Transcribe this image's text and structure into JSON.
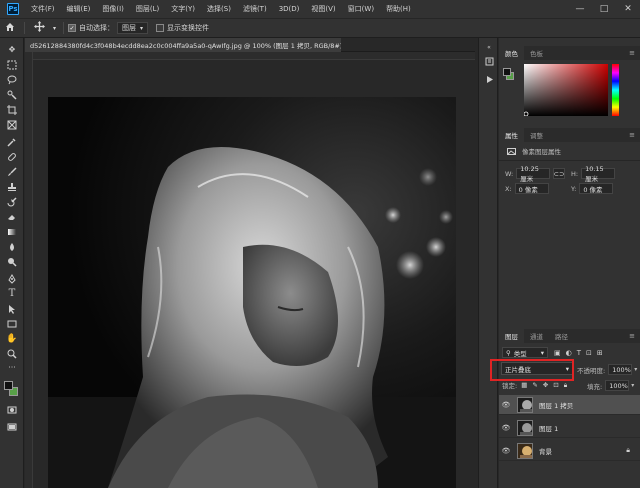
{
  "app": {
    "logo": "Ps"
  },
  "menu": [
    "文件(F)",
    "编辑(E)",
    "图像(I)",
    "图层(L)",
    "文字(Y)",
    "选择(S)",
    "滤镜(T)",
    "3D(D)",
    "视图(V)",
    "窗口(W)",
    "帮助(H)"
  ],
  "window_controls": {
    "minimize": "—",
    "maximize": "□",
    "close": "✕"
  },
  "options": {
    "auto_select_label": "自动选择：",
    "auto_select_value": "图层",
    "show_transform_label": "显示变换控件"
  },
  "document": {
    "tab_title": "d52612884380fd4c3f048b4ecdd8ea2c0c004ffa9a5a0-qAwIfg.jpg @ 100% (图层 1 拷贝, RGB/8#) *",
    "close": "×"
  },
  "color_panel": {
    "tabs": [
      "颜色",
      "色板"
    ],
    "foreground": "#111111",
    "background": "#58a048",
    "hue_color": "#cc0000"
  },
  "properties_panel": {
    "tabs": [
      "属性",
      "调整"
    ],
    "section": "像素图层属性",
    "w_label": "W:",
    "w_value": "10.25 厘米",
    "h_label": "H:",
    "h_value": "10.15 厘米",
    "x_label": "X:",
    "x_value": "0 像素",
    "y_label": "Y:",
    "y_value": "0 像素"
  },
  "layers_panel": {
    "tabs": [
      "图层",
      "通道",
      "路径"
    ],
    "filter_label": "类型",
    "blend_mode": "正片叠底",
    "opacity_label": "不透明度:",
    "opacity_value": "100%",
    "lock_label": "锁定:",
    "fill_label": "填充:",
    "fill_value": "100%",
    "layers": [
      {
        "name": "图层 1 拷贝",
        "selected": true
      },
      {
        "name": "图层 1",
        "selected": false
      },
      {
        "name": "背景",
        "selected": false,
        "locked": true
      }
    ]
  }
}
